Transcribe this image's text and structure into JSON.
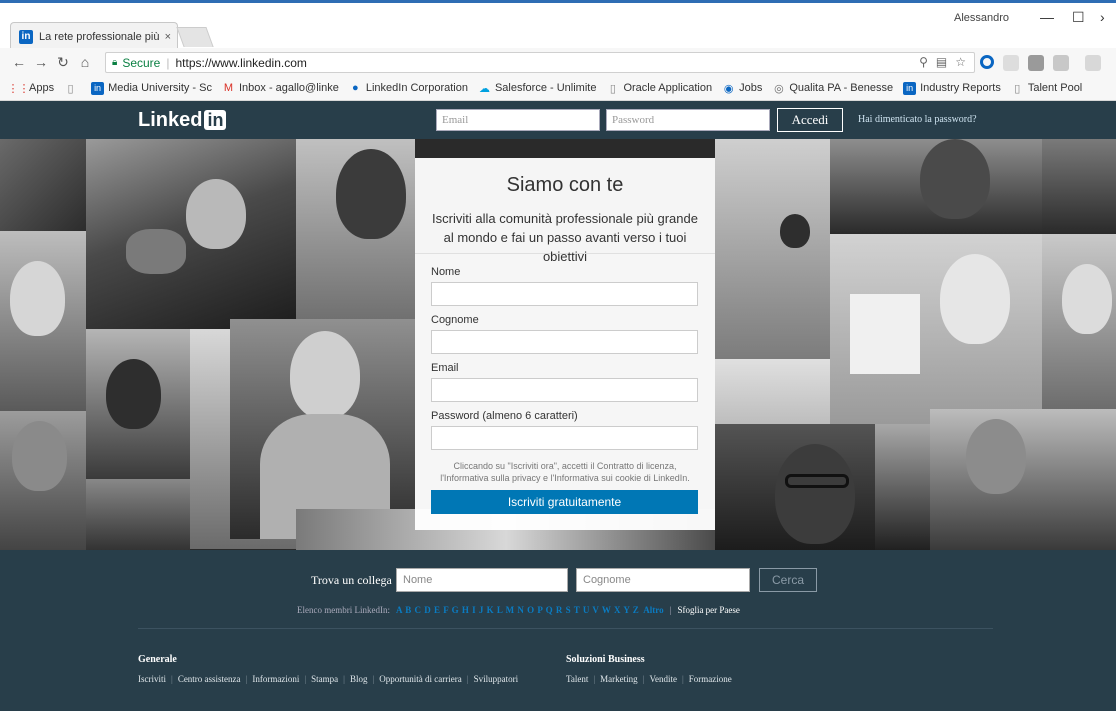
{
  "browser": {
    "tab_title": "La rete professionale più",
    "tab_close": "×",
    "profile_name": "Alessandro",
    "url_secure": "Secure",
    "url": "https://www.linkedin.com",
    "bookmarks": [
      {
        "label": "Apps",
        "icon": "apps-grid-icon",
        "color": "#d93025"
      },
      {
        "label": "",
        "icon": "page-icon",
        "color": "#888888"
      },
      {
        "label": "Media University - Sc",
        "icon": "linkedin-icon",
        "color": "#0a66c2"
      },
      {
        "label": "Inbox - agallo@linke",
        "icon": "gmail-icon",
        "color": "#d93025"
      },
      {
        "label": "LinkedIn Corporation",
        "icon": "circle-icon",
        "color": "#0a66c2"
      },
      {
        "label": "Salesforce - Unlimite",
        "icon": "cloud-icon",
        "color": "#00a1e0"
      },
      {
        "label": "Oracle Application",
        "icon": "page-icon",
        "color": "#888888"
      },
      {
        "label": "Jobs",
        "icon": "jobs-icon",
        "color": "#0a66c2"
      },
      {
        "label": "Qualita PA - Benesse",
        "icon": "globe-icon",
        "color": "#6a6a6a"
      },
      {
        "label": "Industry Reports",
        "icon": "linkedin-icon",
        "color": "#0a66c2"
      },
      {
        "label": "Talent Pool",
        "icon": "page-icon",
        "color": "#888888"
      }
    ]
  },
  "header": {
    "logo_text": "Linked",
    "logo_in": "in",
    "email_placeholder": "Email",
    "password_placeholder": "Password",
    "signin_label": "Accedi",
    "forgot_label": "Hai dimenticato la password?"
  },
  "signup": {
    "title": "Siamo con te",
    "subtitle": "Iscriviti alla comunità professionale più grande al mondo e fai un passo avanti verso i tuoi obiettivi",
    "first_name_label": "Nome",
    "last_name_label": "Cognome",
    "email_label": "Email",
    "password_label": "Password (almeno 6 caratteri)",
    "terms": "Cliccando su \"Iscriviti ora\", accetti il Contratto di licenza, l'Informativa sulla privacy e l'Informativa sui cookie di LinkedIn.",
    "join_label": "Iscriviti gratuitamente"
  },
  "footer": {
    "find_label": "Trova un collega",
    "first_placeholder": "Nome",
    "last_placeholder": "Cognome",
    "search_label": "Cerca",
    "directory_label": "Elenco membri LinkedIn:",
    "letters": "A B C D E F G H I J K L M N O P Q R S T U V W X Y Z",
    "more_label": "Altro",
    "by_country": "Sfoglia per Paese",
    "general_heading": "Generale",
    "general_links": [
      "Iscriviti",
      "Centro assistenza",
      "Informazioni",
      "Stampa",
      "Blog",
      "Opportunità di carriera",
      "Sviluppatori"
    ],
    "business_heading": "Soluzioni Business",
    "business_links": [
      "Talent",
      "Marketing",
      "Vendite",
      "Formazione"
    ]
  },
  "colors": {
    "linkedin_navy": "#283e4a",
    "linkedin_blue": "#0077b5"
  }
}
